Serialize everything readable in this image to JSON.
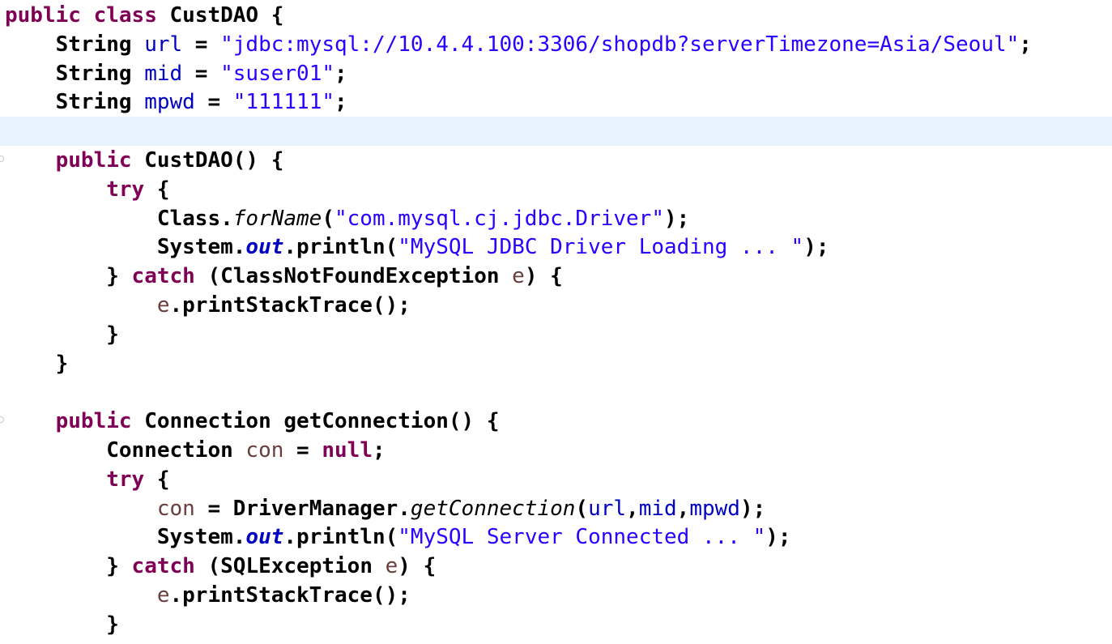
{
  "editor": {
    "colors": {
      "keyword": "#7f0055",
      "string": "#2a00ff",
      "field": "#0000c0",
      "local_variable": "#6a3e3e",
      "default_text": "#000000",
      "current_line_highlight": "#e8f2fe"
    },
    "lines": [
      {
        "tokens": [
          {
            "t": "public",
            "c": "kw"
          },
          {
            "t": " "
          },
          {
            "t": "class",
            "c": "kw"
          },
          {
            "t": " CustDAO {"
          }
        ]
      },
      {
        "tokens": [
          {
            "t": "    String "
          },
          {
            "t": "url",
            "c": "fld"
          },
          {
            "t": " = "
          },
          {
            "t": "\"jdbc:mysql://10.4.4.100:3306/shopdb?serverTimezone=Asia/Seoul\"",
            "c": "str"
          },
          {
            "t": ";"
          }
        ]
      },
      {
        "tokens": [
          {
            "t": "    String "
          },
          {
            "t": "mid",
            "c": "fld"
          },
          {
            "t": " = "
          },
          {
            "t": "\"suser01\"",
            "c": "str"
          },
          {
            "t": ";"
          }
        ]
      },
      {
        "tokens": [
          {
            "t": "    String "
          },
          {
            "t": "mpwd",
            "c": "fld"
          },
          {
            "t": " = "
          },
          {
            "t": "\"111111\"",
            "c": "str"
          },
          {
            "t": ";"
          }
        ]
      },
      {
        "tokens": []
      },
      {
        "tokens": [
          {
            "t": "    "
          },
          {
            "t": "public",
            "c": "kw"
          },
          {
            "t": " CustDAO() {"
          }
        ]
      },
      {
        "tokens": [
          {
            "t": "        "
          },
          {
            "t": "try",
            "c": "kw"
          },
          {
            "t": " {"
          }
        ]
      },
      {
        "tokens": [
          {
            "t": "            Class."
          },
          {
            "t": "forName",
            "c": "ital"
          },
          {
            "t": "("
          },
          {
            "t": "\"com.mysql.cj.jdbc.Driver\"",
            "c": "str"
          },
          {
            "t": ");"
          }
        ]
      },
      {
        "tokens": [
          {
            "t": "            System."
          },
          {
            "t": "out",
            "c": "sfld"
          },
          {
            "t": ".println("
          },
          {
            "t": "\"MySQL JDBC Driver Loading ... \"",
            "c": "str"
          },
          {
            "t": ");"
          }
        ]
      },
      {
        "tokens": [
          {
            "t": "        } "
          },
          {
            "t": "catch",
            "c": "kw"
          },
          {
            "t": " (ClassNotFoundException "
          },
          {
            "t": "e",
            "c": "loc"
          },
          {
            "t": ") {"
          }
        ]
      },
      {
        "tokens": [
          {
            "t": "            "
          },
          {
            "t": "e",
            "c": "loc"
          },
          {
            "t": ".printStackTrace();"
          }
        ]
      },
      {
        "tokens": [
          {
            "t": "        }"
          }
        ]
      },
      {
        "tokens": [
          {
            "t": "    }"
          }
        ]
      },
      {
        "tokens": []
      },
      {
        "tokens": [
          {
            "t": "    "
          },
          {
            "t": "public",
            "c": "kw"
          },
          {
            "t": " Connection getConnection() {"
          }
        ]
      },
      {
        "tokens": [
          {
            "t": "        Connection "
          },
          {
            "t": "con",
            "c": "loc"
          },
          {
            "t": " = "
          },
          {
            "t": "null",
            "c": "kw"
          },
          {
            "t": ";"
          }
        ]
      },
      {
        "tokens": [
          {
            "t": "        "
          },
          {
            "t": "try",
            "c": "kw"
          },
          {
            "t": " {"
          }
        ]
      },
      {
        "tokens": [
          {
            "t": "            "
          },
          {
            "t": "con",
            "c": "loc"
          },
          {
            "t": " = DriverManager."
          },
          {
            "t": "getConnection",
            "c": "ital"
          },
          {
            "t": "("
          },
          {
            "t": "url",
            "c": "fld"
          },
          {
            "t": ","
          },
          {
            "t": "mid",
            "c": "fld"
          },
          {
            "t": ","
          },
          {
            "t": "mpwd",
            "c": "fld"
          },
          {
            "t": ");"
          }
        ]
      },
      {
        "tokens": [
          {
            "t": "            System."
          },
          {
            "t": "out",
            "c": "sfld"
          },
          {
            "t": ".println("
          },
          {
            "t": "\"MySQL Server Connected ... \"",
            "c": "str"
          },
          {
            "t": ");"
          }
        ]
      },
      {
        "tokens": [
          {
            "t": "        } "
          },
          {
            "t": "catch",
            "c": "kw"
          },
          {
            "t": " (SQLException "
          },
          {
            "t": "e",
            "c": "loc"
          },
          {
            "t": ") {"
          }
        ]
      },
      {
        "tokens": [
          {
            "t": "            "
          },
          {
            "t": "e",
            "c": "loc"
          },
          {
            "t": ".printStackTrace();"
          }
        ]
      },
      {
        "tokens": [
          {
            "t": "        }"
          }
        ]
      }
    ]
  }
}
